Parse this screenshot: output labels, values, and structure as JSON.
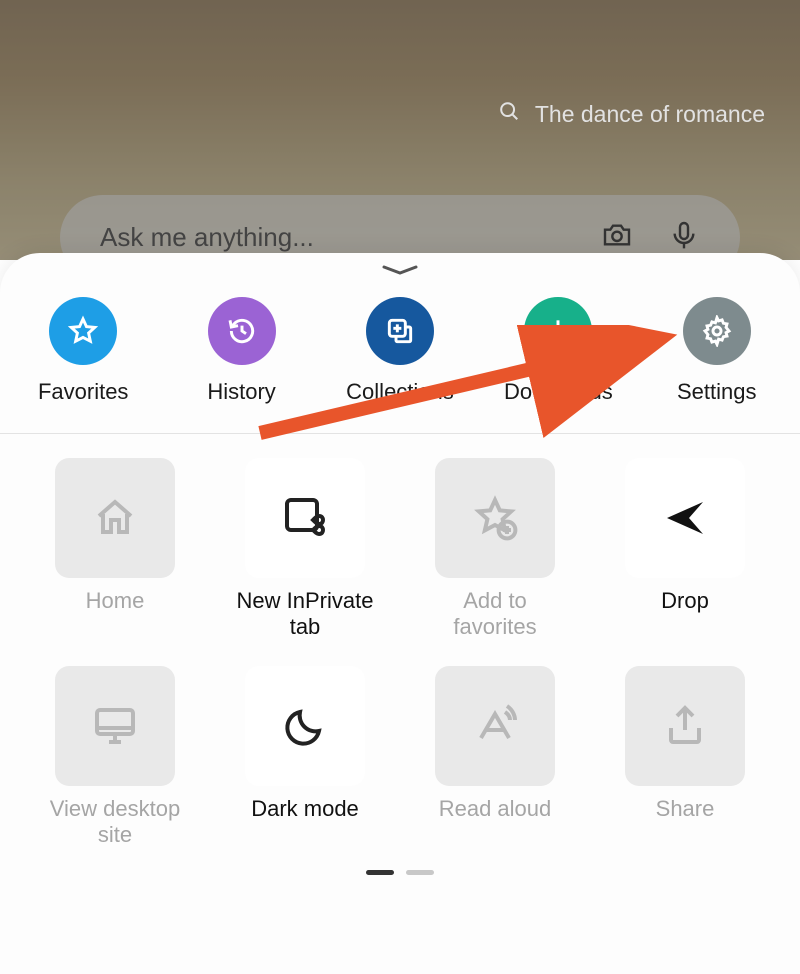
{
  "topSearch": {
    "suggestion": "The dance of romance"
  },
  "searchBar": {
    "placeholder": "Ask me anything..."
  },
  "quick": [
    {
      "key": "favorites",
      "label": "Favorites",
      "color": "#1e9ee6",
      "icon": "star"
    },
    {
      "key": "history",
      "label": "History",
      "color": "#9b63d4",
      "icon": "history"
    },
    {
      "key": "collections",
      "label": "Collections",
      "color": "#16589e",
      "icon": "collections"
    },
    {
      "key": "downloads",
      "label": "Downloads",
      "color": "#17b08a",
      "icon": "download"
    },
    {
      "key": "settings",
      "label": "Settings",
      "color": "#7e8b8e",
      "icon": "gear"
    }
  ],
  "grid": [
    {
      "key": "home",
      "label": "Home",
      "icon": "home",
      "enabled": false
    },
    {
      "key": "inprivate",
      "label": "New InPrivate tab",
      "icon": "private",
      "enabled": true
    },
    {
      "key": "addfav",
      "label": "Add to favorites",
      "icon": "staradd",
      "enabled": false
    },
    {
      "key": "drop",
      "label": "Drop",
      "icon": "send",
      "enabled": true
    },
    {
      "key": "desktop",
      "label": "View desktop site",
      "icon": "monitor",
      "enabled": false
    },
    {
      "key": "darkmode",
      "label": "Dark mode",
      "icon": "moon",
      "enabled": true
    },
    {
      "key": "readaloud",
      "label": "Read aloud",
      "icon": "readaloud",
      "enabled": false
    },
    {
      "key": "share",
      "label": "Share",
      "icon": "share",
      "enabled": false
    }
  ],
  "annotation": {
    "pointsTo": "settings"
  }
}
